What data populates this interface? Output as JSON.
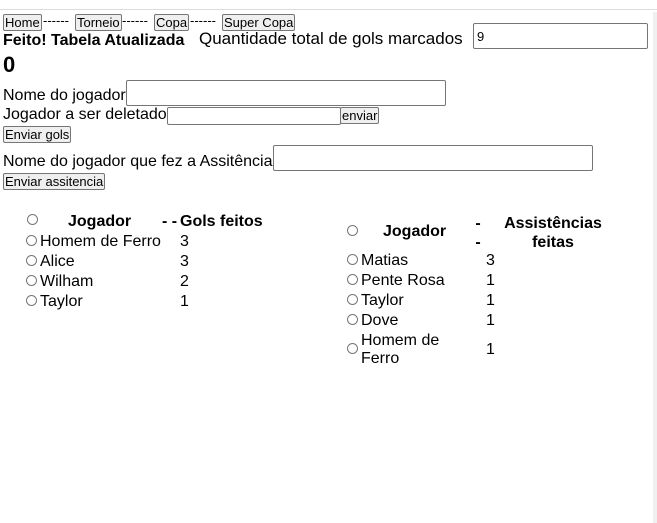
{
  "nav": {
    "buttons": [
      "Home",
      "Torneio",
      "Copa",
      "Super Copa"
    ],
    "separator": "------"
  },
  "status": {
    "message": "Feito! Tabela Atualizada",
    "total_label": "Quantidade total de gols marcados",
    "total_input_value": "9",
    "score": "0"
  },
  "form": {
    "player_label": "Nome do jogador",
    "player_value": "",
    "delete_label": "Jogador a ser deletado",
    "delete_value": "",
    "enviar_label": "enviar",
    "send_goals_label": "Enviar gols",
    "assist_label": "Nome do jogador que fez a Assitência",
    "assist_value": "",
    "send_assist_label": "Enviar assitencia"
  },
  "goals_table": {
    "header_player": "Jogador",
    "header_sep": "- -",
    "header_goals": "Gols feitos",
    "rows": [
      {
        "player": "Homem de Ferro",
        "goals": "3"
      },
      {
        "player": "Alice",
        "goals": "3"
      },
      {
        "player": "Wilham",
        "goals": "2"
      },
      {
        "player": "Taylor",
        "goals": "1"
      }
    ]
  },
  "assists_table": {
    "header_player": "Jogador",
    "header_sep": "-\n-",
    "header_assists": "Assistências feitas",
    "rows": [
      {
        "player": "Matias",
        "assists": "3"
      },
      {
        "player": "Pente Rosa",
        "assists": "1"
      },
      {
        "player": "Taylor",
        "assists": "1"
      },
      {
        "player": "Dove",
        "assists": "1"
      },
      {
        "player": "Homem de Ferro",
        "assists": "1"
      }
    ]
  }
}
